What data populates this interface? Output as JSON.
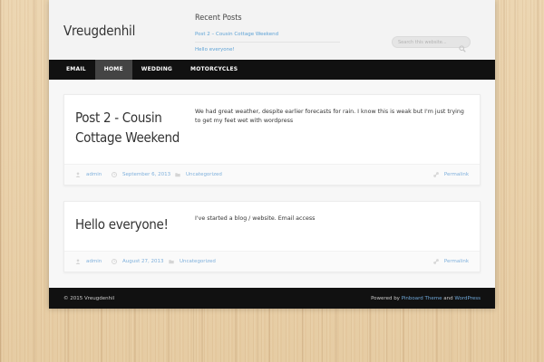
{
  "header": {
    "site_title": "Vreugdenhil",
    "recent_posts": {
      "title": "Recent Posts",
      "items": [
        "Post 2 – Cousin Cottage Weekend",
        "Hello everyone!"
      ]
    },
    "search": {
      "placeholder": "Search this website..."
    }
  },
  "nav": {
    "items": [
      "EMAIL",
      "HOME",
      "WEDDING",
      "MOTORCYCLES"
    ],
    "active": "HOME"
  },
  "posts": [
    {
      "title": "Post 2 - Cousin Cottage Weekend",
      "content": "We had great weather, despite earlier forecasts for rain.   I know this is weak but I'm just trying to get my feet wet with wordpress",
      "author": "admin",
      "date": "September 6, 2013",
      "category": "Uncategorized",
      "permalink": "Permalink"
    },
    {
      "title": "Hello everyone!",
      "content": "I've started a blog / website. Email access",
      "author": "admin",
      "date": "August 27, 2013",
      "category": "Uncategorized",
      "permalink": "Permalink"
    }
  ],
  "footer": {
    "copyright": "© 2015 Vreugdenhil",
    "powered_prefix": "Powered by",
    "theme_link": "Pinboard Theme",
    "and": "and",
    "wp_link": "WordPress"
  },
  "colors": {
    "link": "#5fa3d6",
    "nav_bg": "#111111",
    "nav_active_bg": "#444444"
  }
}
